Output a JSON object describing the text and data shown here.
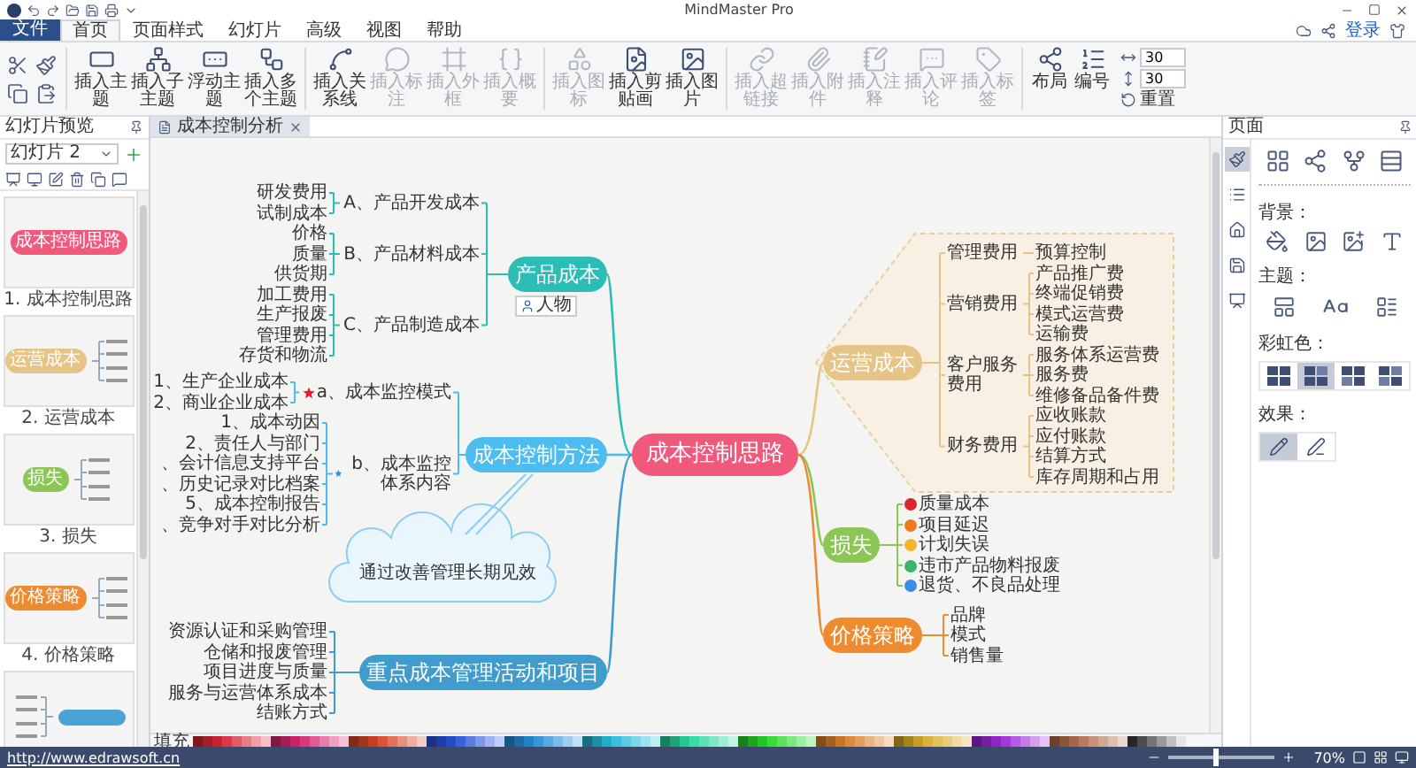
{
  "window": {
    "title": "MindMaster Pro"
  },
  "menu": {
    "file": "文件",
    "tabs": [
      {
        "label": "首页",
        "selected": true
      },
      {
        "label": "页面样式",
        "selected": false
      },
      {
        "label": "幻灯片",
        "selected": false
      },
      {
        "label": "高级",
        "selected": false
      },
      {
        "label": "视图",
        "selected": false
      },
      {
        "label": "帮助",
        "selected": false
      }
    ],
    "login": "登录"
  },
  "ribbon": {
    "groups": [
      {
        "buttons": [
          {
            "label": "插入主题",
            "disabled": false
          },
          {
            "label": "插入子主题",
            "disabled": false
          },
          {
            "label": "浮动主题",
            "disabled": false
          },
          {
            "label": "插入多个主题",
            "disabled": false
          }
        ]
      },
      {
        "buttons": [
          {
            "label": "插入关系线",
            "disabled": false
          },
          {
            "label": "插入标注",
            "disabled": true
          },
          {
            "label": "插入外框",
            "disabled": true
          },
          {
            "label": "插入概要",
            "disabled": true
          }
        ]
      },
      {
        "buttons": [
          {
            "label": "插入图标",
            "disabled": true
          },
          {
            "label": "插入剪贴画",
            "disabled": false
          },
          {
            "label": "插入图片",
            "disabled": false
          }
        ]
      },
      {
        "buttons": [
          {
            "label": "插入超链接",
            "disabled": true
          },
          {
            "label": "插入附件",
            "disabled": true
          },
          {
            "label": "插入注释",
            "disabled": true
          },
          {
            "label": "插入评论",
            "disabled": true
          },
          {
            "label": "插入标签",
            "disabled": true
          }
        ]
      },
      {
        "buttons": [
          {
            "label": "布局",
            "disabled": false
          },
          {
            "label": "编号",
            "disabled": false
          }
        ]
      }
    ],
    "spacing": [
      "30",
      "30"
    ],
    "reset": "重置"
  },
  "slides_panel": {
    "title": "幻灯片预览",
    "selector": "幻灯片 2",
    "slides": [
      {
        "caption": "1. 成本控制思路",
        "topic": "成本控制思路",
        "color": "#f0587c",
        "kind": "title"
      },
      {
        "caption": "2. 运营成本",
        "topic": "运营成本",
        "color": "#e6c487",
        "kind": "right"
      },
      {
        "caption": "3. 损失",
        "topic": "损失",
        "color": "#8dc657",
        "kind": "right"
      },
      {
        "caption": "4. 价格策略",
        "topic": "价格策略",
        "color": "#ee8a30",
        "kind": "right"
      },
      {
        "color": "#4aa3d6",
        "kind": "left"
      }
    ]
  },
  "document_tab": "成本控制分析",
  "mind_map": {
    "central": "成本控制思路",
    "branches": [
      {
        "title": "产品成本",
        "color": "#2bbdb6",
        "tag": "人物",
        "children": [
          {
            "label": "A、产品开发成本",
            "children": [
              {
                "label": "研发费用"
              },
              {
                "label": "试制成本"
              }
            ]
          },
          {
            "label": "B、产品材料成本",
            "children": [
              {
                "label": "价格"
              },
              {
                "label": "质量"
              },
              {
                "label": "供货期"
              }
            ]
          },
          {
            "label": "C、产品制造成本",
            "children": [
              {
                "label": "加工费用"
              },
              {
                "label": "生产报废"
              },
              {
                "label": "管理费用"
              },
              {
                "label": "存货和物流"
              }
            ]
          }
        ]
      },
      {
        "title": "成本控制方法",
        "color": "#4dbdf0",
        "callout": "通过改善管理长期见效",
        "children": [
          {
            "label": "a、成本监控模式",
            "kind": "star",
            "color": "#e0202e",
            "children": [
              {
                "label": "1、生产企业成本"
              },
              {
                "label": "2、商业企业成本"
              }
            ]
          },
          {
            "label": "b、成本监控体系内容",
            "kind": "star",
            "color": "#2f8de4",
            "children": [
              {
                "label": "1、成本动因"
              },
              {
                "label": "2、责任人与部门"
              },
              {
                "label": "、会计信息支持平台"
              },
              {
                "label": "、历史记录对比档案"
              },
              {
                "label": "5、成本控制报告"
              },
              {
                "label": "、竞争对手对比分析"
              }
            ]
          }
        ]
      },
      {
        "title": "重点成本管理活动和项目",
        "color": "#3f9ccc",
        "children": [
          {
            "label": "资源认证和采购管理"
          },
          {
            "label": "仓储和报废管理"
          },
          {
            "label": "项目进度与质量"
          },
          {
            "label": "服务与运营体系成本"
          },
          {
            "label": "结账方式"
          }
        ]
      },
      {
        "title": "运营成本",
        "color": "#e6c487",
        "boundary": true,
        "children": [
          {
            "label": "管理费用",
            "children": [
              {
                "label": "预算控制"
              }
            ]
          },
          {
            "label": "营销费用",
            "children": [
              {
                "label": "产品推广费"
              },
              {
                "label": "终端促销费"
              },
              {
                "label": "模式运营费"
              },
              {
                "label": "运输费"
              }
            ]
          },
          {
            "label": "客户服务费用",
            "children": [
              {
                "label": "服务体系运营费"
              },
              {
                "label": "服务费"
              },
              {
                "label": "维修备品备件费"
              }
            ]
          },
          {
            "label": "财务费用",
            "children": [
              {
                "label": "应收账款"
              },
              {
                "label": "应付账款"
              },
              {
                "label": "结算方式"
              },
              {
                "label": "库存周期和占用"
              }
            ]
          }
        ]
      },
      {
        "title": "损失",
        "color": "#8dc657",
        "children": [
          {
            "label": "质量成本",
            "kind": "priority",
            "color": "#d9262c"
          },
          {
            "label": "项目延迟",
            "kind": "priority",
            "color": "#f07a22"
          },
          {
            "label": "计划失误",
            "kind": "priority",
            "color": "#f5b52a"
          },
          {
            "label": "违市产品物料报废",
            "kind": "priority",
            "color": "#3cb371"
          },
          {
            "label": "退货、不良品处理",
            "kind": "priority",
            "color": "#3a8ee6"
          }
        ]
      },
      {
        "title": "价格策略",
        "color": "#ee8a30",
        "children": [
          {
            "label": "品牌"
          },
          {
            "label": "模式"
          },
          {
            "label": "销售量"
          }
        ]
      }
    ]
  },
  "palette": {
    "label": "填充"
  },
  "properties_panel": {
    "title": "页面",
    "side_tabs": [
      {
        "selected": true
      },
      {
        "selected": false
      },
      {
        "selected": false
      },
      {
        "selected": false
      },
      {
        "selected": false
      }
    ],
    "background_label": "背景：",
    "theme_label": "主题：",
    "rainbow": {
      "label": "彩虹色：",
      "options": [
        {
          "selected": false
        },
        {
          "selected": true
        },
        {
          "selected": false
        },
        {
          "selected": false
        }
      ]
    },
    "effects": {
      "label": "效果：",
      "options": [
        {
          "selected": true
        },
        {
          "selected": false
        }
      ]
    }
  },
  "status_bar": {
    "link": "http://www.edrawsoft.cn",
    "zoom": {
      "level": 0.45,
      "reading": "70%"
    }
  }
}
